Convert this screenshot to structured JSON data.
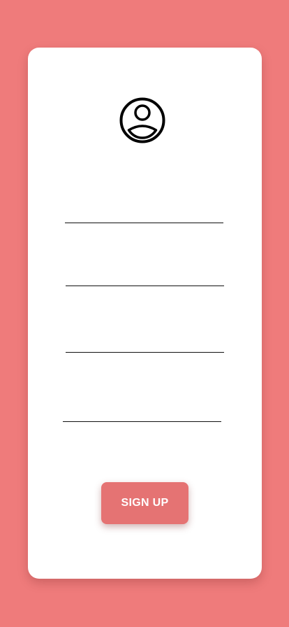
{
  "form": {
    "fields": [
      {
        "value": "",
        "placeholder": ""
      },
      {
        "value": "",
        "placeholder": ""
      },
      {
        "value": "",
        "placeholder": ""
      },
      {
        "value": "",
        "placeholder": ""
      }
    ],
    "signup_label": "SIGN UP"
  },
  "icons": {
    "avatar": "account-circle-icon"
  },
  "colors": {
    "background": "#ef7b7b",
    "card": "#ffffff",
    "button": "#e57373",
    "button_text": "#ffffff"
  }
}
